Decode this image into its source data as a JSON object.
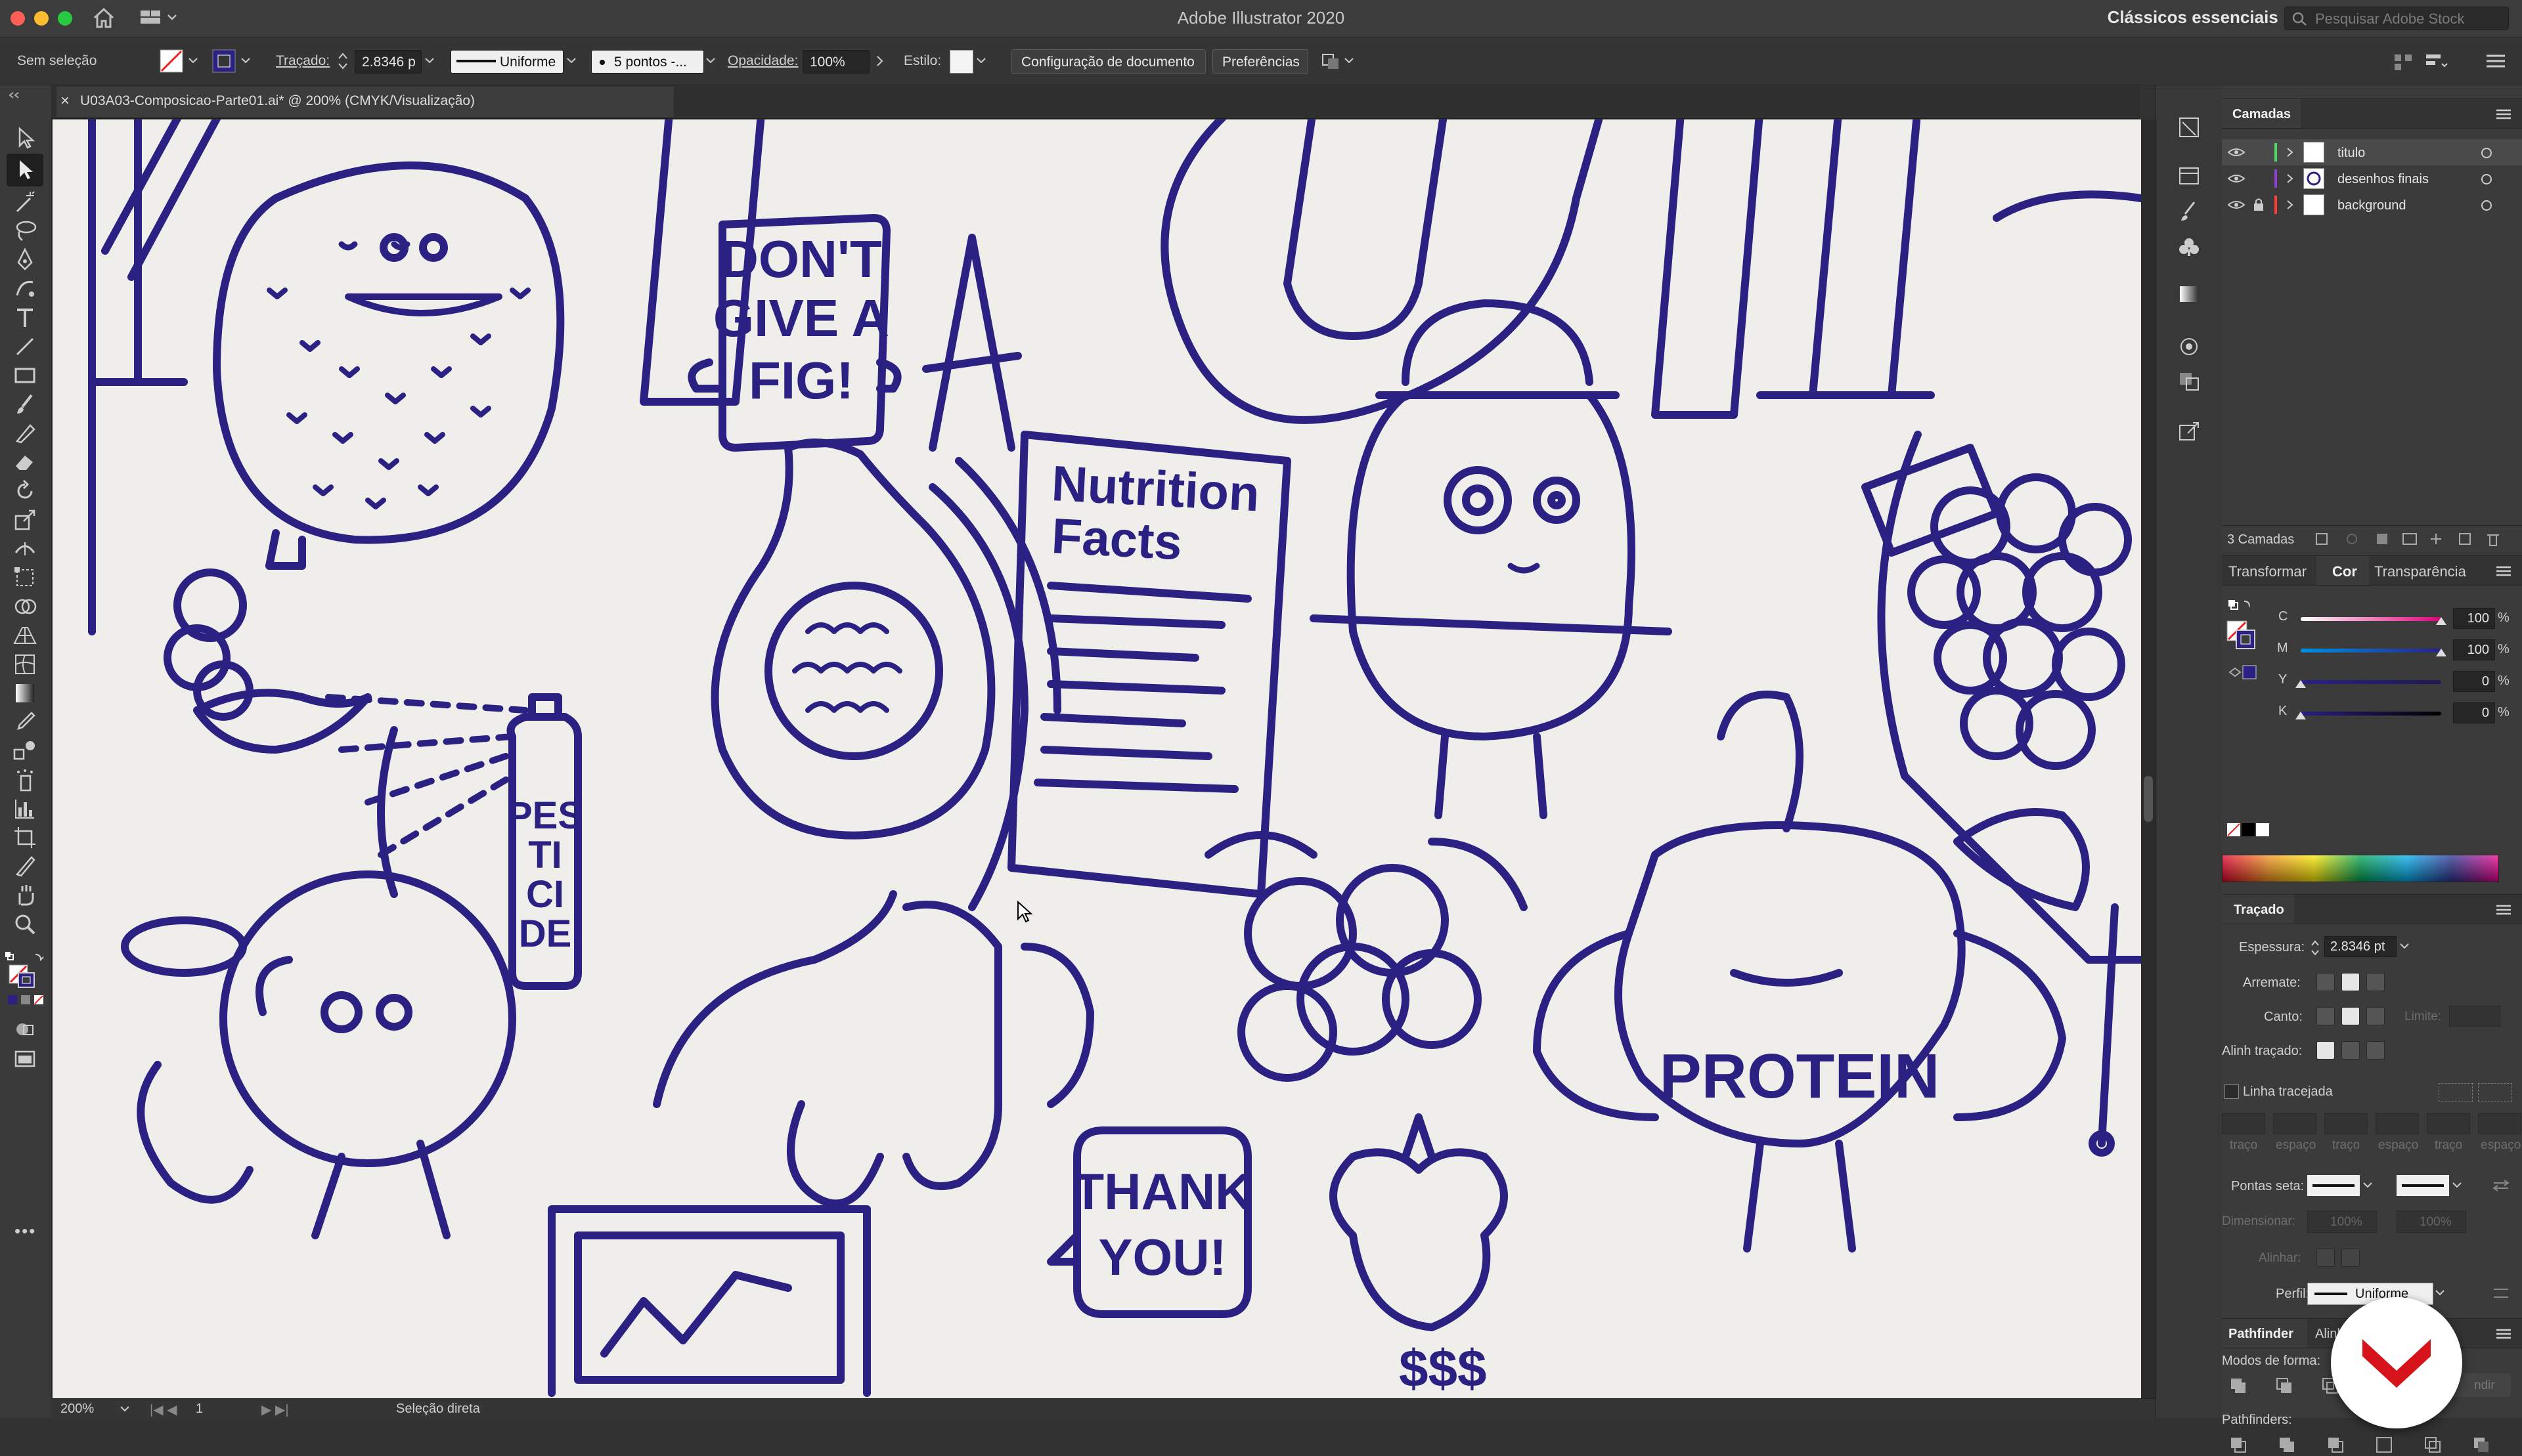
{
  "app": {
    "title": "Adobe Illustrator 2020",
    "workspace": "Clássicos essenciais",
    "search_placeholder": "Pesquisar Adobe Stock"
  },
  "controlbar": {
    "selection_status": "Sem seleção",
    "stroke_label": "Traçado:",
    "stroke_value": "2.8346 p",
    "profile_value": "Uniforme",
    "brush_value": "5 pontos -...",
    "opacity_label": "Opacidade:",
    "opacity_value": "100%",
    "style_label": "Estilo:",
    "doc_setup_button": "Configuração de documento",
    "preferences_button": "Preferências"
  },
  "document": {
    "tab_label": "U03A03-Composicao-Parte01.ai* @ 200% (CMYK/Visualização)",
    "close_glyph": "×",
    "art_words": {
      "fig": [
        "DON'T",
        "GIVE A",
        "FIG!"
      ],
      "nutrition": [
        "Nutrition",
        "Facts"
      ],
      "pesticide": [
        "PES",
        "TI",
        "CI",
        "DE"
      ],
      "thanks": [
        "THANK",
        "YOU!"
      ],
      "protein": "PROTEIN",
      "dollars": "$$$"
    }
  },
  "status": {
    "zoom": "200%",
    "artboard": "1",
    "tool": "Seleção direta"
  },
  "layers_panel": {
    "title": "Camadas",
    "layers": [
      {
        "name": "titulo",
        "color": "#4cd964"
      },
      {
        "name": "desenhos finais",
        "color": "#8b3fd9"
      },
      {
        "name": "background",
        "color": "#ff3b30"
      }
    ],
    "count_label": "3 Camadas"
  },
  "color_panel": {
    "tabs": [
      "Transformar",
      "Cor",
      "Transparência"
    ],
    "channels": [
      {
        "label": "C",
        "value": "100"
      },
      {
        "label": "M",
        "value": "100"
      },
      {
        "label": "Y",
        "value": "0"
      },
      {
        "label": "K",
        "value": "0"
      }
    ],
    "percent": "%"
  },
  "stroke_panel": {
    "title": "Traçado",
    "weight_label": "Espessura:",
    "weight_value": "2.8346 pt",
    "cap_label": "Arremate:",
    "corner_label": "Canto:",
    "limit_label": "Limite:",
    "align_label": "Alinh traçado:",
    "dashed_label": "Linha tracejada",
    "dash_labels": [
      "traço",
      "espaço",
      "traço",
      "espaço",
      "traço",
      "espaço"
    ],
    "arrowheads_label": "Pontas seta:",
    "scale_label": "Dimensionar:",
    "scale_values": [
      "100%",
      "100%"
    ],
    "align_arrow_label": "Alinhar:",
    "profile_label": "Perfil:",
    "profile_value": "Uniforme"
  },
  "pathfinder_panel": {
    "tabs": [
      "Pathfinder",
      "Alinh"
    ],
    "shape_modes_label": "Modos de forma:",
    "expand_label": "ndir",
    "pathfinders_label": "Pathfinders:"
  },
  "colors": {
    "ink": "#2a2183",
    "paper": "#efeeea",
    "badge_red": "#d6121b"
  }
}
